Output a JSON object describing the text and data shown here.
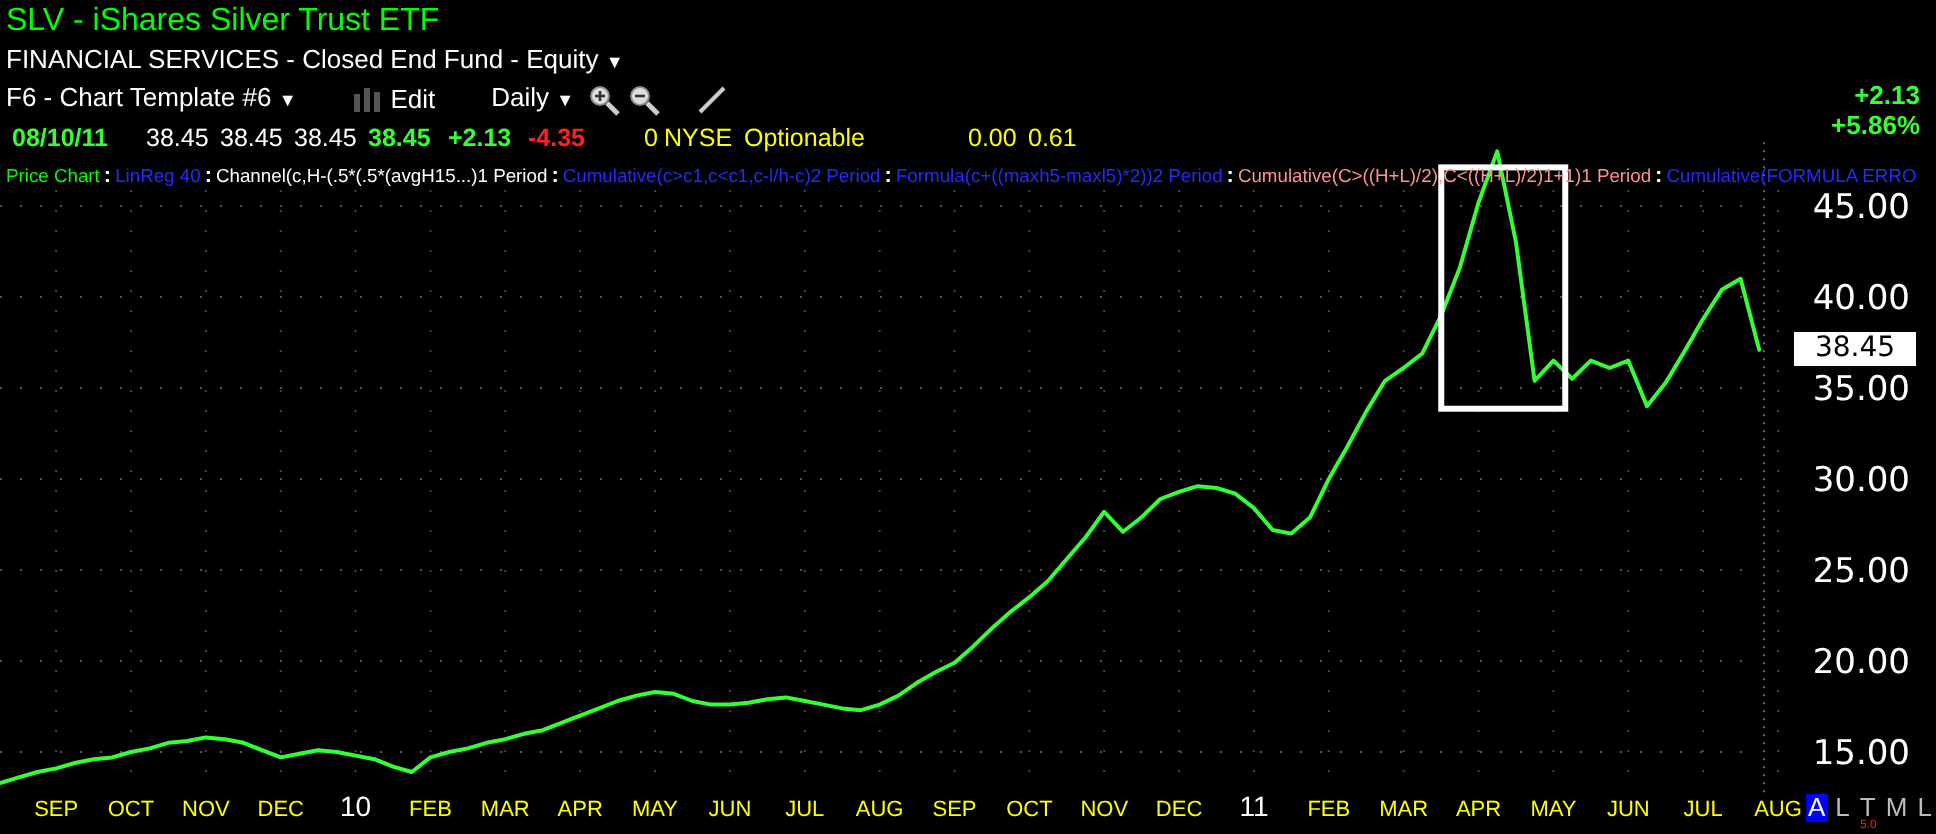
{
  "header": {
    "title": "SLV - iShares Silver Trust ETF",
    "category": "FINANCIAL SERVICES - Closed End Fund - Equity",
    "category_caret": "▼",
    "template": "F6 - Chart Template #6",
    "template_caret": "▼",
    "edit": "Edit",
    "period": "Daily",
    "period_caret": "▼"
  },
  "quote": [
    {
      "text": "08/10/11",
      "color": "#33ff33",
      "bold": true
    },
    {
      "text": "38.45",
      "color": "#ffffff",
      "bold": false
    },
    {
      "text": "38.45",
      "color": "#ffffff",
      "bold": false
    },
    {
      "text": "38.45",
      "color": "#ffffff",
      "bold": false
    },
    {
      "text": "38.45",
      "color": "#33ff33",
      "bold": true
    },
    {
      "text": "+2.13",
      "color": "#33ff33",
      "bold": true
    },
    {
      "text": "-4.35",
      "color": "#ff2020",
      "bold": true
    },
    {
      "text": "0",
      "color": "#ffff00",
      "bold": false
    },
    {
      "text": "NYSE",
      "color": "#ffff00",
      "bold": false
    },
    {
      "text": "Optionable",
      "color": "#ffff00",
      "bold": false
    },
    {
      "text": "0.00",
      "color": "#ffff00",
      "bold": false
    },
    {
      "text": "0.61",
      "color": "#ffff00",
      "bold": false
    }
  ],
  "change": {
    "points": "+2.13",
    "percent": "+5.86%"
  },
  "indicators": [
    {
      "text": "Price Chart",
      "color": "#00ff00"
    },
    {
      "text": ":",
      "color": "#ffffff"
    },
    {
      "text": "LinReg 40",
      "color": "#2828ff"
    },
    {
      "text": ":",
      "color": "#ffffff"
    },
    {
      "text": "Channel(c,H-(.5*(.5*(avgH15...)1 Period",
      "color": "#ffffff"
    },
    {
      "text": ":",
      "color": "#ffffff"
    },
    {
      "text": "Cumulative(c>c1,c<c1,c-l/h-c)2 Period",
      "color": "#2828ff"
    },
    {
      "text": ":",
      "color": "#ffffff"
    },
    {
      "text": "Formula(c+((maxh5-maxl5)*2))2 Period",
      "color": "#2828ff"
    },
    {
      "text": ":",
      "color": "#ffffff"
    },
    {
      "text": "Cumulative(C>((H+L)/2),C<((H+L)/2)1+1)1 Period",
      "color": "#ff9090"
    },
    {
      "text": ":",
      "color": "#ffffff"
    },
    {
      "text": "Cumulative(FORMULA ERRO",
      "color": "#2828ff"
    }
  ],
  "chart": {
    "last_price": "38.45",
    "highlight": {
      "kind": "box"
    },
    "chart_data": {
      "type": "line",
      "grid": true,
      "ylim": [
        12.5,
        48.5
      ],
      "categories": [
        null,
        null,
        null,
        "SEP",
        null,
        null,
        null,
        "OCT",
        null,
        null,
        null,
        "NOV",
        null,
        null,
        null,
        "DEC",
        null,
        null,
        null,
        "10",
        null,
        null,
        null,
        "FEB",
        null,
        null,
        null,
        "MAR",
        null,
        null,
        null,
        "APR",
        null,
        null,
        null,
        "MAY",
        null,
        null,
        null,
        "JUN",
        null,
        null,
        null,
        "JUL",
        null,
        null,
        null,
        "AUG",
        null,
        null,
        null,
        "SEP",
        null,
        null,
        null,
        "OCT",
        null,
        null,
        null,
        "NOV",
        null,
        null,
        null,
        "DEC",
        null,
        null,
        null,
        "11",
        null,
        null,
        null,
        "FEB",
        null,
        null,
        null,
        "MAR",
        null,
        null,
        null,
        "APR",
        null,
        null,
        null,
        "MAY",
        null,
        null,
        null,
        "JUN",
        null,
        null,
        null,
        "JUL",
        null,
        null,
        null,
        "AUG"
      ],
      "yticks": [
        {
          "value": 15,
          "label": "15.00"
        },
        {
          "value": 20,
          "label": "20.00"
        },
        {
          "value": 25,
          "label": "25.00"
        },
        {
          "value": 30,
          "label": "30.00"
        },
        {
          "value": 35,
          "label": "35.00"
        },
        {
          "value": 40,
          "label": "40.00"
        },
        {
          "value": 45,
          "label": "45.00"
        }
      ],
      "series": [
        {
          "color": "#33ff33",
          "values": [
            13.3,
            13.6,
            13.9,
            14.1,
            14.4,
            14.6,
            14.7,
            15.0,
            15.2,
            15.5,
            15.6,
            15.8,
            15.7,
            15.5,
            15.1,
            14.7,
            14.9,
            15.1,
            15.0,
            14.8,
            14.6,
            14.2,
            13.9,
            14.7,
            15.0,
            15.2,
            15.5,
            15.7,
            16.0,
            16.2,
            16.6,
            17.0,
            17.4,
            17.8,
            18.1,
            18.3,
            18.2,
            17.8,
            17.6,
            17.6,
            17.7,
            17.9,
            18.0,
            17.8,
            17.6,
            17.4,
            17.3,
            17.6,
            18.1,
            18.8,
            19.4,
            19.9,
            20.8,
            21.8,
            22.7,
            23.5,
            24.4,
            25.6,
            26.8,
            28.2,
            27.1,
            27.9,
            28.9,
            29.3,
            29.6,
            29.5,
            29.2,
            28.4,
            27.2,
            27.0,
            27.9,
            30.0,
            31.8,
            33.7,
            35.4,
            36.1,
            36.9,
            39.0,
            41.6,
            45.2,
            48.0,
            43.0,
            35.4,
            36.5,
            35.5,
            36.5,
            36.1,
            36.5,
            34.0,
            35.3,
            37.0,
            38.8,
            40.4,
            41.0,
            37.1,
            null
          ]
        }
      ]
    }
  },
  "scale_modes": [
    {
      "text": "A",
      "selected": true
    },
    {
      "text": "L",
      "selected": false
    },
    {
      "text": "T",
      "selected": false
    },
    {
      "text": "M",
      "selected": false
    },
    {
      "text": "L",
      "selected": false
    }
  ],
  "bottom_value": "5.0"
}
